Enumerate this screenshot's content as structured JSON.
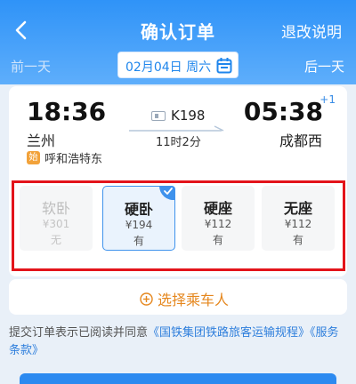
{
  "header": {
    "title": "确认订单",
    "refund_link": "退改说明",
    "prev_day": "前一天",
    "next_day": "后一天",
    "date": "02月04日 周六"
  },
  "trip": {
    "dep_time": "18:36",
    "dep_station": "兰州",
    "origin_badge": "始",
    "origin_text": "呼和浩特东",
    "train_no": "K198",
    "duration": "11时2分",
    "arr_time": "05:38",
    "day_offset": "+1",
    "arr_station": "成都西"
  },
  "seats": [
    {
      "name": "软卧",
      "price": "¥301",
      "avail": "无",
      "state": "disabled"
    },
    {
      "name": "硬卧",
      "price": "¥194",
      "avail": "有",
      "state": "selected"
    },
    {
      "name": "硬座",
      "price": "¥112",
      "avail": "有",
      "state": "normal"
    },
    {
      "name": "无座",
      "price": "¥112",
      "avail": "有",
      "state": "normal"
    }
  ],
  "passenger": {
    "add_label": "选择乘车人"
  },
  "agreement": {
    "prefix": "提交订单表示已阅读并同意",
    "link1": "《国铁集团铁路旅客运输规程》",
    "link2": "《服务条款》"
  },
  "colors": {
    "brand_blue": "#2f93f8",
    "accent_orange": "#e5871e",
    "highlight_red": "#e3141b"
  }
}
